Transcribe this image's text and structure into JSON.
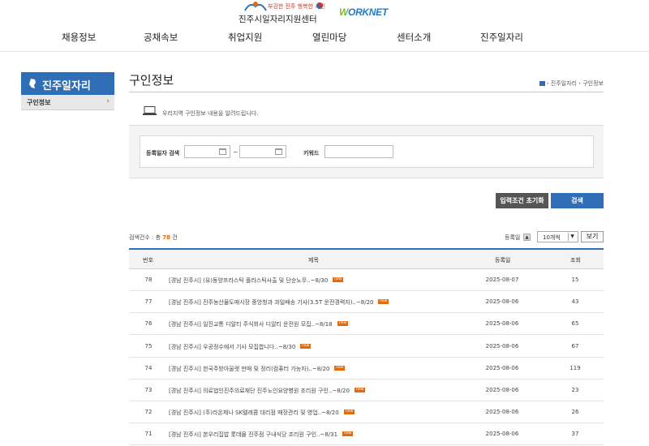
{
  "header": {
    "slogan": "부강한 진주 행복한 시민",
    "center_name": "진주시일자리지원센터",
    "partner_logo_w": "W",
    "partner_logo_rest": "ORKNET",
    "nav": [
      {
        "label": "채용정보"
      },
      {
        "label": "공채속보"
      },
      {
        "label": "취업지원"
      },
      {
        "label": "열린마당"
      },
      {
        "label": "센터소개"
      },
      {
        "label": "진주일자리"
      }
    ]
  },
  "sidebar": {
    "title": "진주일자리",
    "items": [
      {
        "label": "구인정보",
        "arrow": "›"
      }
    ]
  },
  "main": {
    "title": "구인정보",
    "breadcrumb": "› 진주일자리 › 구인정보",
    "intro": "우리지역 구인정보 내용을 알려드립니다."
  },
  "search": {
    "date_label": "등록일자 검색",
    "tilde": "~",
    "keyword_label": "키워드",
    "start_date": "",
    "end_date": "",
    "keyword": "",
    "reset_label": "입력조건 초기화",
    "search_label": "검색"
  },
  "list": {
    "count_prefix": "검색건수 : 총",
    "count": "78",
    "count_suffix": "건",
    "sort_label": "등록일",
    "sort_arrow": "▲",
    "page_size": "10개씩",
    "dropdown_arrow": "▼",
    "view_label": "보기",
    "headers": {
      "no": "번호",
      "title": "제목",
      "date": "등록일",
      "views": "조회"
    },
    "new_label": "new",
    "rows": [
      {
        "no": "78",
        "title": "[경남 진주시] (유)동양프라스틱 플라스틱사출 및 단순노무..~8/30",
        "date": "2025-08-07",
        "views": "15"
      },
      {
        "no": "77",
        "title": "[경남 진주시] 진주농산물도매시장 중앙청과 과일배송 기사(3.5T 운전경력자)..~8/20",
        "date": "2025-08-06",
        "views": "43"
      },
      {
        "no": "76",
        "title": "[경남 진주시] 일진교통 디알티 주식회사 디알티 운전원 모집..~8/18",
        "date": "2025-08-06",
        "views": "65"
      },
      {
        "no": "75",
        "title": "[경남 진주시] 우공정수에서 기사 모집합니다..~8/30",
        "date": "2025-08-06",
        "views": "67"
      },
      {
        "no": "74",
        "title": "[경남 진주시] 한국주방아울렛 판매 및 정리(컴퓨터 가능자)..~8/20",
        "date": "2025-08-06",
        "views": "119"
      },
      {
        "no": "73",
        "title": "[경남 진주시] 의료법인진주의료재단 진주노인요양병원 조리원 구인..~8/20",
        "date": "2025-08-06",
        "views": "23"
      },
      {
        "no": "72",
        "title": "[경남 진주시] (주)라온제나 SK텔레콤 대리점 매장관리 및 영업..~8/20",
        "date": "2025-08-06",
        "views": "26"
      },
      {
        "no": "71",
        "title": "[경남 진주시] 본우리집밥 롯데몰 진주점 구내식당 조리원 구인..~8/31",
        "date": "2025-08-06",
        "views": "37"
      }
    ]
  },
  "colors": {
    "primary": "#2f6eb6",
    "accent": "#e26a0f",
    "dark_button": "#555555"
  }
}
